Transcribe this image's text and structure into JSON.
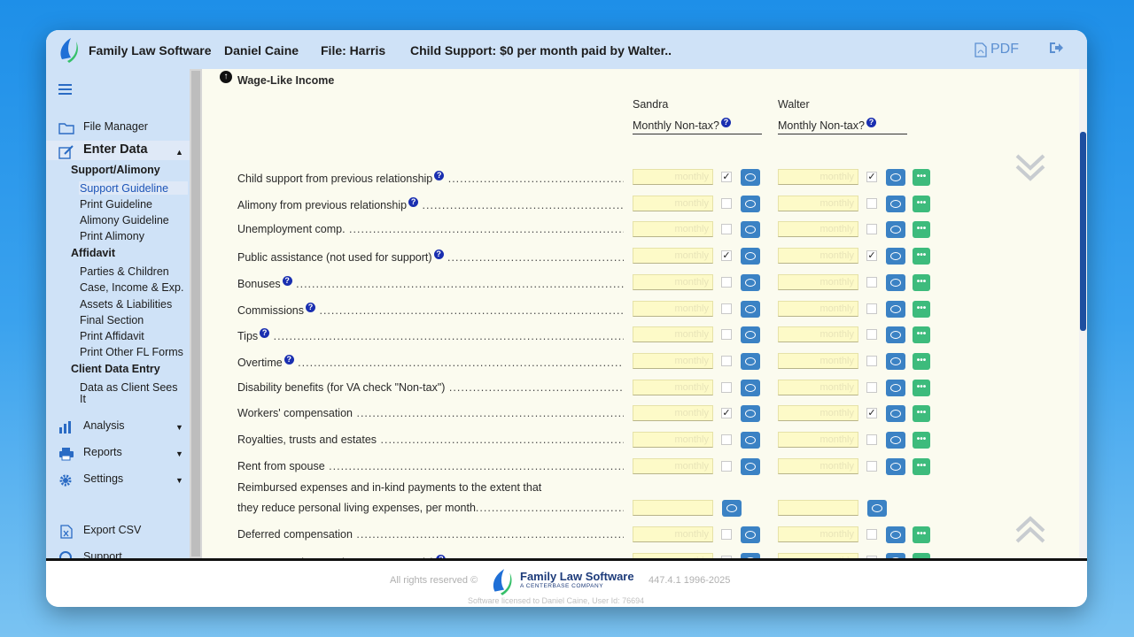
{
  "header": {
    "app_title": "Family Law Software",
    "user": "Daniel Caine",
    "file": "File: Harris",
    "child_support": "Child Support: $0 per month paid by Walter..",
    "pdf_label": "PDF"
  },
  "sidebar": {
    "file_manager": "File Manager",
    "enter_data": "Enter Data",
    "support_alimony": "Support/Alimony",
    "support_guideline": "Support Guideline",
    "print_guideline": "Print Guideline",
    "alimony_guideline": "Alimony Guideline",
    "print_alimony": "Print Alimony",
    "affidavit": "Affidavit",
    "parties_children": "Parties & Children",
    "case_income": "Case, Income & Exp.",
    "assets_liabilities": "Assets & Liabilities",
    "final_section": "Final Section",
    "print_affidavit": "Print Affidavit",
    "print_other": "Print Other FL Forms",
    "client_data_entry": "Client Data Entry",
    "data_as_client_1": "Data as Client Sees",
    "data_as_client_2": "It",
    "analysis": "Analysis",
    "reports": "Reports",
    "settings": "Settings",
    "export_csv": "Export CSV",
    "support": "Support"
  },
  "main": {
    "section_title": "Wage-Like Income",
    "col1_name": "Sandra",
    "col2_name": "Walter",
    "col_sub": "Monthly Non-tax?",
    "input_placeholder": "monthly",
    "rows": [
      {
        "label": "Child support from previous relationship",
        "help": true,
        "c1": true,
        "c2": true,
        "more": true
      },
      {
        "label": "Alimony from previous relationship",
        "help": true,
        "c1": false,
        "c2": false,
        "more": true
      },
      {
        "label": "Unemployment comp.",
        "help": false,
        "c1": false,
        "c2": false,
        "more": true
      },
      {
        "label": "Public assistance (not used for support)",
        "help": true,
        "c1": true,
        "c2": true,
        "more": true
      },
      {
        "label": "Bonuses",
        "help": true,
        "c1": false,
        "c2": false,
        "more": true
      },
      {
        "label": "Commissions",
        "help": true,
        "c1": false,
        "c2": false,
        "more": true
      },
      {
        "label": "Tips",
        "help": true,
        "c1": false,
        "c2": false,
        "more": true
      },
      {
        "label": "Overtime",
        "help": true,
        "c1": false,
        "c2": false,
        "more": true
      },
      {
        "label": "Disability benefits (for VA check \"Non-tax\")",
        "help": false,
        "c1": false,
        "c2": false,
        "more": true
      },
      {
        "label": "Workers' compensation",
        "help": false,
        "c1": true,
        "c2": true,
        "more": true
      },
      {
        "label": "Royalties, trusts and estates",
        "help": false,
        "c1": false,
        "c2": false,
        "more": true
      },
      {
        "label": "Rent from spouse",
        "help": false,
        "c1": false,
        "c2": false,
        "more": true
      }
    ],
    "reimbursed_line1": "Reimbursed expenses and in-kind payments to the extent that",
    "reimbursed_line2": "they reduce personal living expenses, per month",
    "rows_after": [
      {
        "label": "Deferred compensation",
        "help": false,
        "c1": false,
        "c2": false,
        "more": true
      },
      {
        "label": "New spouse income (tax purposes only)",
        "help": true,
        "c1": false,
        "c2": false,
        "more": true
      }
    ]
  },
  "footer": {
    "rights": "All rights reserved ©",
    "brand": "Family Law Software",
    "brand_sub": "A CENTERBASE COMPANY",
    "version": "447.4.1 1996-2025",
    "license": "Software licensed to Daniel Caine, User Id: 76694"
  },
  "colors": {
    "topbar": "#cfe2f7",
    "note_button": "#3b82c4",
    "more_button": "#3dbb7c",
    "scroll_thumb": "#1d4fa0"
  }
}
